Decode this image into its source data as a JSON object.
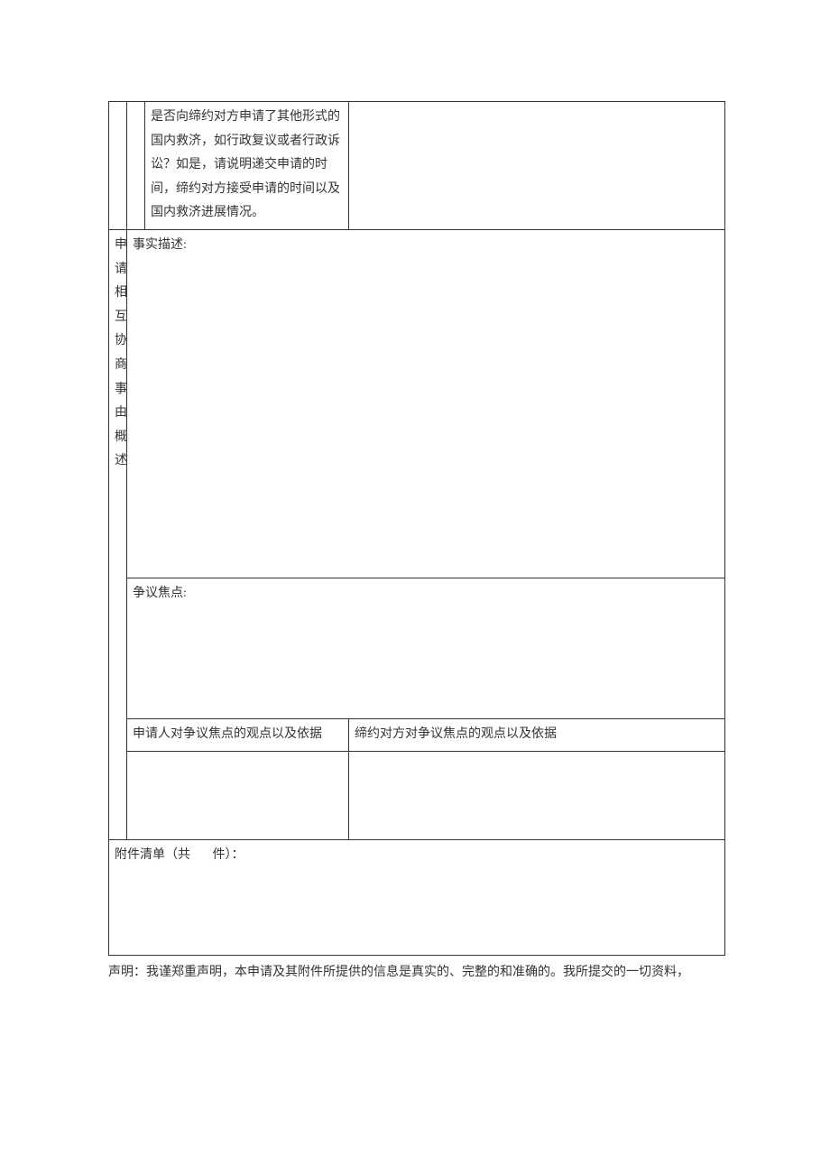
{
  "section1": {
    "question": "是否向缔约对方申请了其他形式的国内救济，如行政复议或者行政诉讼？如是，请说明递交申请的时间，缔约对方接受申请的时间以及国内救济进展情况。"
  },
  "section2": {
    "label_line1": "申",
    "label_line1b": "请",
    "label_line2": "相",
    "label_line2b": "互",
    "label_line3": "协",
    "label_line3b": "商",
    "label_line4": "事",
    "label_line4b": "由",
    "label_line5": "概",
    "label_line5b": "述",
    "facts_label": "事实描述:",
    "dispute_label": "争议焦点:",
    "applicant_view_label": "申请人对争议焦点的观点以及依据",
    "counterparty_view_label": "缔约对方对争议焦点的观点以及依据"
  },
  "attachments": {
    "prefix": "附件清单（共",
    "suffix": "件）："
  },
  "declaration": {
    "text": "声明：我谨郑重声明，本申请及其附件所提供的信息是真实的、完整的和准确的。我所提交的一切资料，"
  }
}
